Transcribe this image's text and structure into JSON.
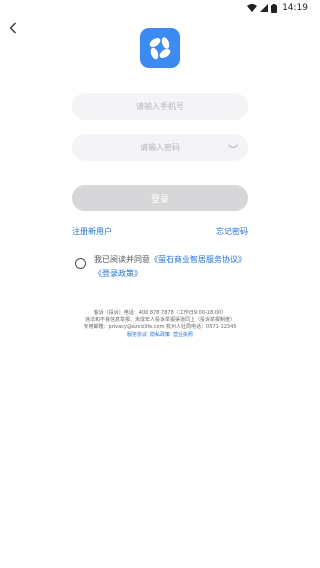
{
  "status_bar": {
    "time": "14:19"
  },
  "icons": {
    "back": "chevron-left-icon",
    "logo": "ezviz-petal-logo",
    "wifi": "wifi-icon",
    "signal": "signal-icon",
    "battery": "battery-icon",
    "eye": "eye-closed-icon"
  },
  "colors": {
    "logo_bg": "#3c8bf2",
    "link": "#1f6fd6",
    "button_disabled": "#d7d7d9",
    "field_bg": "#f4f4f6"
  },
  "form": {
    "phone_placeholder": "请输入手机号",
    "password_placeholder": "请输入密码",
    "login_label": "登录",
    "register_label": "注册新用户",
    "forgot_label": "忘记密码"
  },
  "agreement": {
    "prefix": "我已阅读并同意",
    "service_doc": "《萤石商业智居服务协议》",
    "login_policy": "《登录政策》"
  },
  "footer": {
    "line1": "客诉（投诉）电话：400 878 7878（工作日9:00-18:00）",
    "line2": "违法和不良信息举报、未成年人投诉举报渠道同上（投诉举报制度）",
    "line3": "专用邮箱：privacy@ezvizlife.com 杭州人社局电话：0571-12345",
    "links": [
      "服务协议",
      "隐私政策",
      "营业执照"
    ]
  }
}
